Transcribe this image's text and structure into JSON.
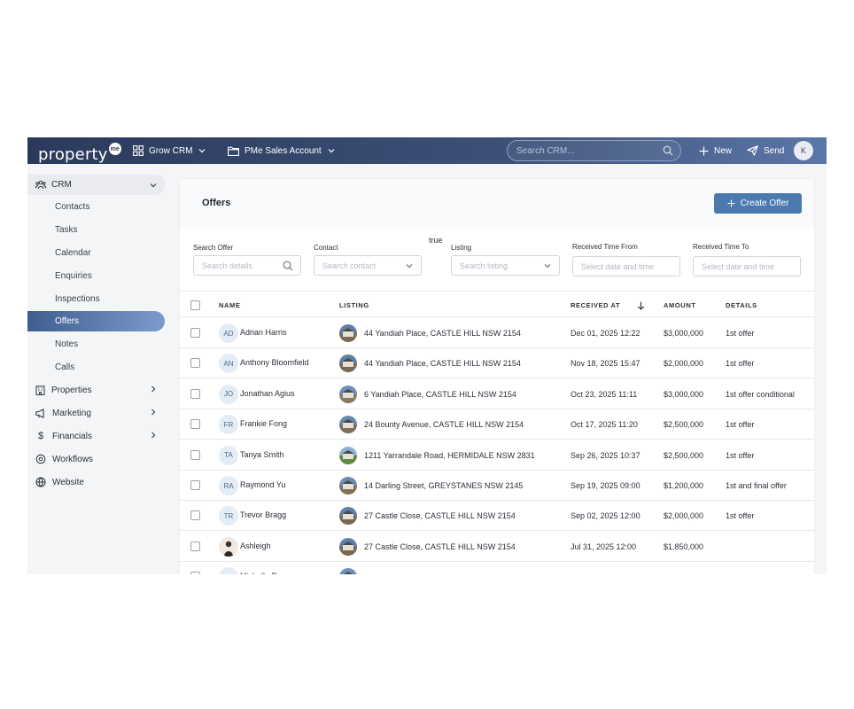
{
  "topbar": {
    "logo_text": "property",
    "logo_badge": "me",
    "grow_crm": "Grow CRM",
    "account": "PMe Sales Account",
    "search_placeholder": "Search CRM...",
    "new_label": "New",
    "send_label": "Send",
    "avatar_initial": "K"
  },
  "sidebar": {
    "crm_label": "CRM",
    "crm_items": [
      "Contacts",
      "Tasks",
      "Calendar",
      "Enquiries",
      "Inspections",
      "Offers",
      "Notes",
      "Calls"
    ],
    "active_item": "Offers",
    "main_items": [
      {
        "label": "Properties",
        "icon": "building-icon",
        "has_chevron": true
      },
      {
        "label": "Marketing",
        "icon": "megaphone-icon",
        "has_chevron": true
      },
      {
        "label": "Financials",
        "icon": "dollar-icon",
        "has_chevron": true
      },
      {
        "label": "Workflows",
        "icon": "workflow-icon",
        "has_chevron": false
      },
      {
        "label": "Website",
        "icon": "globe-icon",
        "has_chevron": false
      }
    ],
    "collapse_glyph": "«"
  },
  "page": {
    "title": "Offers",
    "create_button": "Create Offer",
    "stray_text": "true"
  },
  "filters": {
    "search_offer": {
      "label": "Search Offer",
      "placeholder": "Search details"
    },
    "contact": {
      "label": "Contact",
      "placeholder": "Search contact"
    },
    "listing": {
      "label": "Listing",
      "placeholder": "Search listing"
    },
    "received_from": {
      "label": "Received Time From",
      "placeholder": "Select date and time"
    },
    "received_to": {
      "label": "Received Time To",
      "placeholder": "Select date and time"
    }
  },
  "table": {
    "headers": {
      "name": "NAME",
      "listing": "LISTING",
      "received_at": "RECEIVED AT",
      "amount": "AMOUNT",
      "details": "DETAILS"
    },
    "rows": [
      {
        "initials": "AD",
        "name": "Adrian Harris",
        "listing": "44 Yandiah Place, CASTLE HILL NSW 2154",
        "received": "Dec 01, 2025 12:22",
        "amount": "$3,000,000",
        "details": "1st offer"
      },
      {
        "initials": "AN",
        "name": "Anthony Bloomfield",
        "listing": "44 Yandiah Place, CASTLE HILL NSW 2154",
        "received": "Nov 18, 2025 15:47",
        "amount": "$2,000,000",
        "details": "1st offer"
      },
      {
        "initials": "JO",
        "name": "Jonathan Agius",
        "listing": "6 Yandiah Place, CASTLE HILL NSW 2154",
        "received": "Oct 23, 2025 11:11",
        "amount": "$3,000,000",
        "details": "1st offer conditional"
      },
      {
        "initials": "FR",
        "name": "Frankie Fong",
        "listing": "24 Bounty Avenue, CASTLE HILL NSW 2154",
        "received": "Oct 17, 2025 11:20",
        "amount": "$2,500,000",
        "details": "1st offer"
      },
      {
        "initials": "TA",
        "name": "Tanya Smith",
        "listing": "1211 Yarrandale Road, HERMIDALE NSW 2831",
        "received": "Sep 26, 2025 10:37",
        "amount": "$2,500,000",
        "details": "1st offer"
      },
      {
        "initials": "RA",
        "name": "Raymond Yu",
        "listing": "14 Darling Street, GREYSTANES NSW 2145",
        "received": "Sep 19, 2025 09:00",
        "amount": "$1,200,000",
        "details": "1st and final offer"
      },
      {
        "initials": "TR",
        "name": "Trevor Bragg",
        "listing": "27 Castle Close, CASTLE HILL NSW 2154",
        "received": "Sep 02, 2025 12:00",
        "amount": "$2,000,000",
        "details": "1st offer"
      },
      {
        "initials": "",
        "name": "Ashleigh",
        "listing": "27 Castle Close, CASTLE HILL NSW 2154",
        "received": "Jul 31, 2025 12:00",
        "amount": "$1,850,000",
        "details": ""
      },
      {
        "initials": "MI",
        "name": "Michelle P",
        "listing": "",
        "received": "",
        "amount": "",
        "details": ""
      }
    ]
  },
  "colors": {
    "topbar_start": "#2b3a5c",
    "topbar_end": "#5b77a8",
    "accent": "#4b79b0",
    "active_nav": "#3f5e8f"
  }
}
